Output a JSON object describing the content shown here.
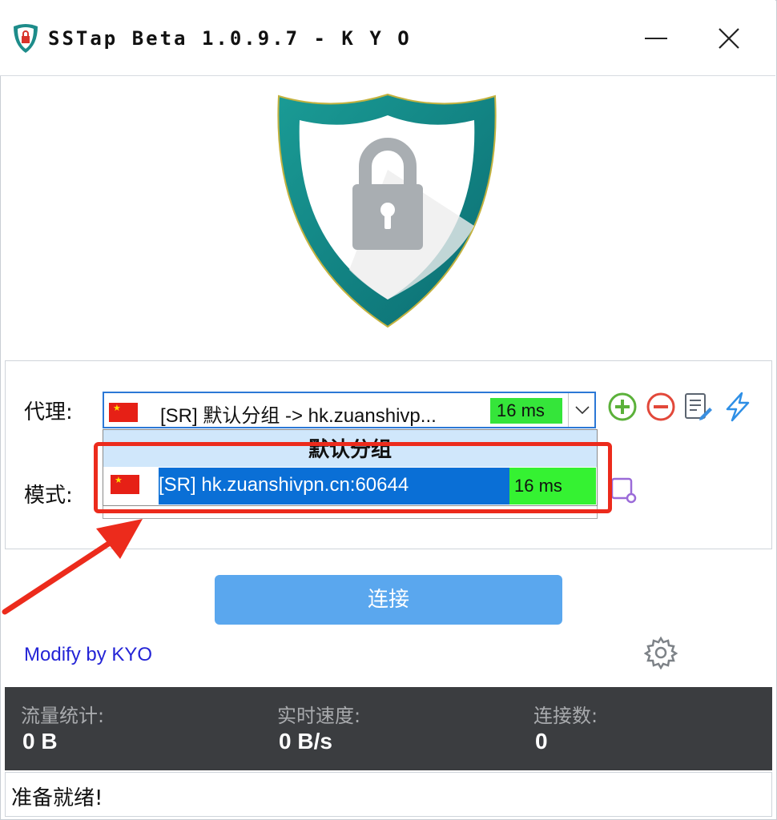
{
  "window": {
    "title": "SSTap Beta 1.0.9.7 - K Y O"
  },
  "proxy": {
    "label": "代理:",
    "selected_text": "[SR] 默认分组 -> hk.zuanshivp...",
    "selected_latency": "16 ms",
    "dropdown": {
      "group_header": "默认分组",
      "items": [
        {
          "text": "[SR] hk.zuanshivpn.cn:60644",
          "latency": "16 ms"
        }
      ]
    }
  },
  "mode": {
    "label": "模式:"
  },
  "connect_label": "连接",
  "modify_link": "Modify by KYO",
  "stats": {
    "traffic_label": "流量统计:",
    "traffic_value": "0 B",
    "speed_label": "实时速度:",
    "speed_value": "0 B/s",
    "connections_label": "连接数:",
    "connections_value": "0"
  },
  "status_text": "准备就绪!",
  "colors": {
    "shield_teal": "#0f8a8a",
    "connect_blue": "#5aa7ee",
    "latency_green": "#35e53a",
    "highlight_blue": "#0a6fd6",
    "annotation_red": "#ec2b1c",
    "stats_bg": "#3b3d40"
  },
  "icons": {
    "app": "shield-lock-icon",
    "add": "plus-circle-icon",
    "remove": "minus-circle-icon",
    "edit": "edit-document-icon",
    "speedtest": "lightning-icon",
    "settings": "gear-icon"
  }
}
